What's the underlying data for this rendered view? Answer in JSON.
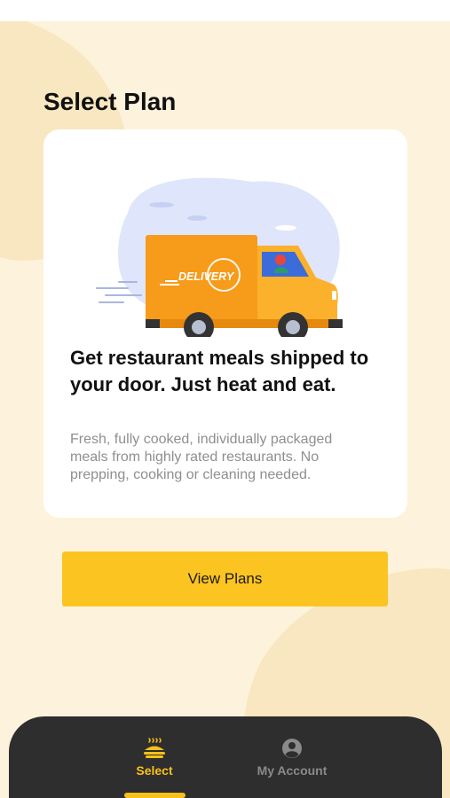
{
  "page": {
    "title": "Select Plan"
  },
  "card": {
    "illustration_text": "DELIVERY",
    "headline": "Get restaurant meals shipped to your door. Just heat and eat.",
    "body": "Fresh, fully cooked, individually packaged meals from highly rated restaurants. No prepping, cooking or cleaning needed."
  },
  "cta": {
    "label": "View Plans"
  },
  "tabbar": {
    "tabs": [
      {
        "label": "Select",
        "icon": "food-tray-icon",
        "active": true
      },
      {
        "label": "My Account",
        "icon": "user-icon",
        "active": false
      }
    ]
  },
  "colors": {
    "background": "#fdf3dc",
    "accent": "#fcc420",
    "truck": "#f79b1a",
    "tabbar": "#2e2e2e",
    "muted_text": "#8f8f8f"
  }
}
